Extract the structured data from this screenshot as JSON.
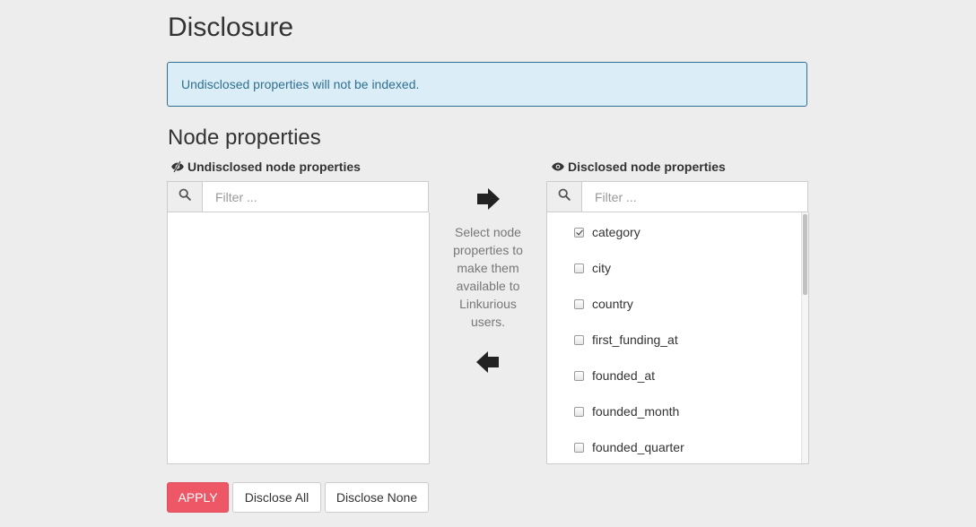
{
  "page": {
    "title": "Disclosure"
  },
  "alert": {
    "text": "Undisclosed properties will not be indexed."
  },
  "section": {
    "title": "Node properties"
  },
  "undisclosed": {
    "label": "Undisclosed node properties",
    "icon": "eye-slash-icon",
    "filter_placeholder": "Filter ...",
    "items": []
  },
  "disclosed": {
    "label": "Disclosed node properties",
    "icon": "eye-icon",
    "filter_placeholder": "Filter ...",
    "items": [
      {
        "label": "category",
        "checked": true
      },
      {
        "label": "city",
        "checked": false
      },
      {
        "label": "country",
        "checked": false
      },
      {
        "label": "first_funding_at",
        "checked": false
      },
      {
        "label": "founded_at",
        "checked": false
      },
      {
        "label": "founded_month",
        "checked": false
      },
      {
        "label": "founded_quarter",
        "checked": false
      }
    ]
  },
  "middle": {
    "help_lines": [
      "Select node",
      "properties to",
      "make them",
      "available to",
      "Linkurious",
      "users."
    ]
  },
  "buttons": {
    "apply": "APPLY",
    "disclose_all": "Disclose All",
    "disclose_none": "Disclose None"
  },
  "colors": {
    "apply_bg": "#ee5766",
    "alert_bg": "#dbedf7",
    "alert_border": "#2f6f92",
    "alert_text": "#31708f"
  }
}
